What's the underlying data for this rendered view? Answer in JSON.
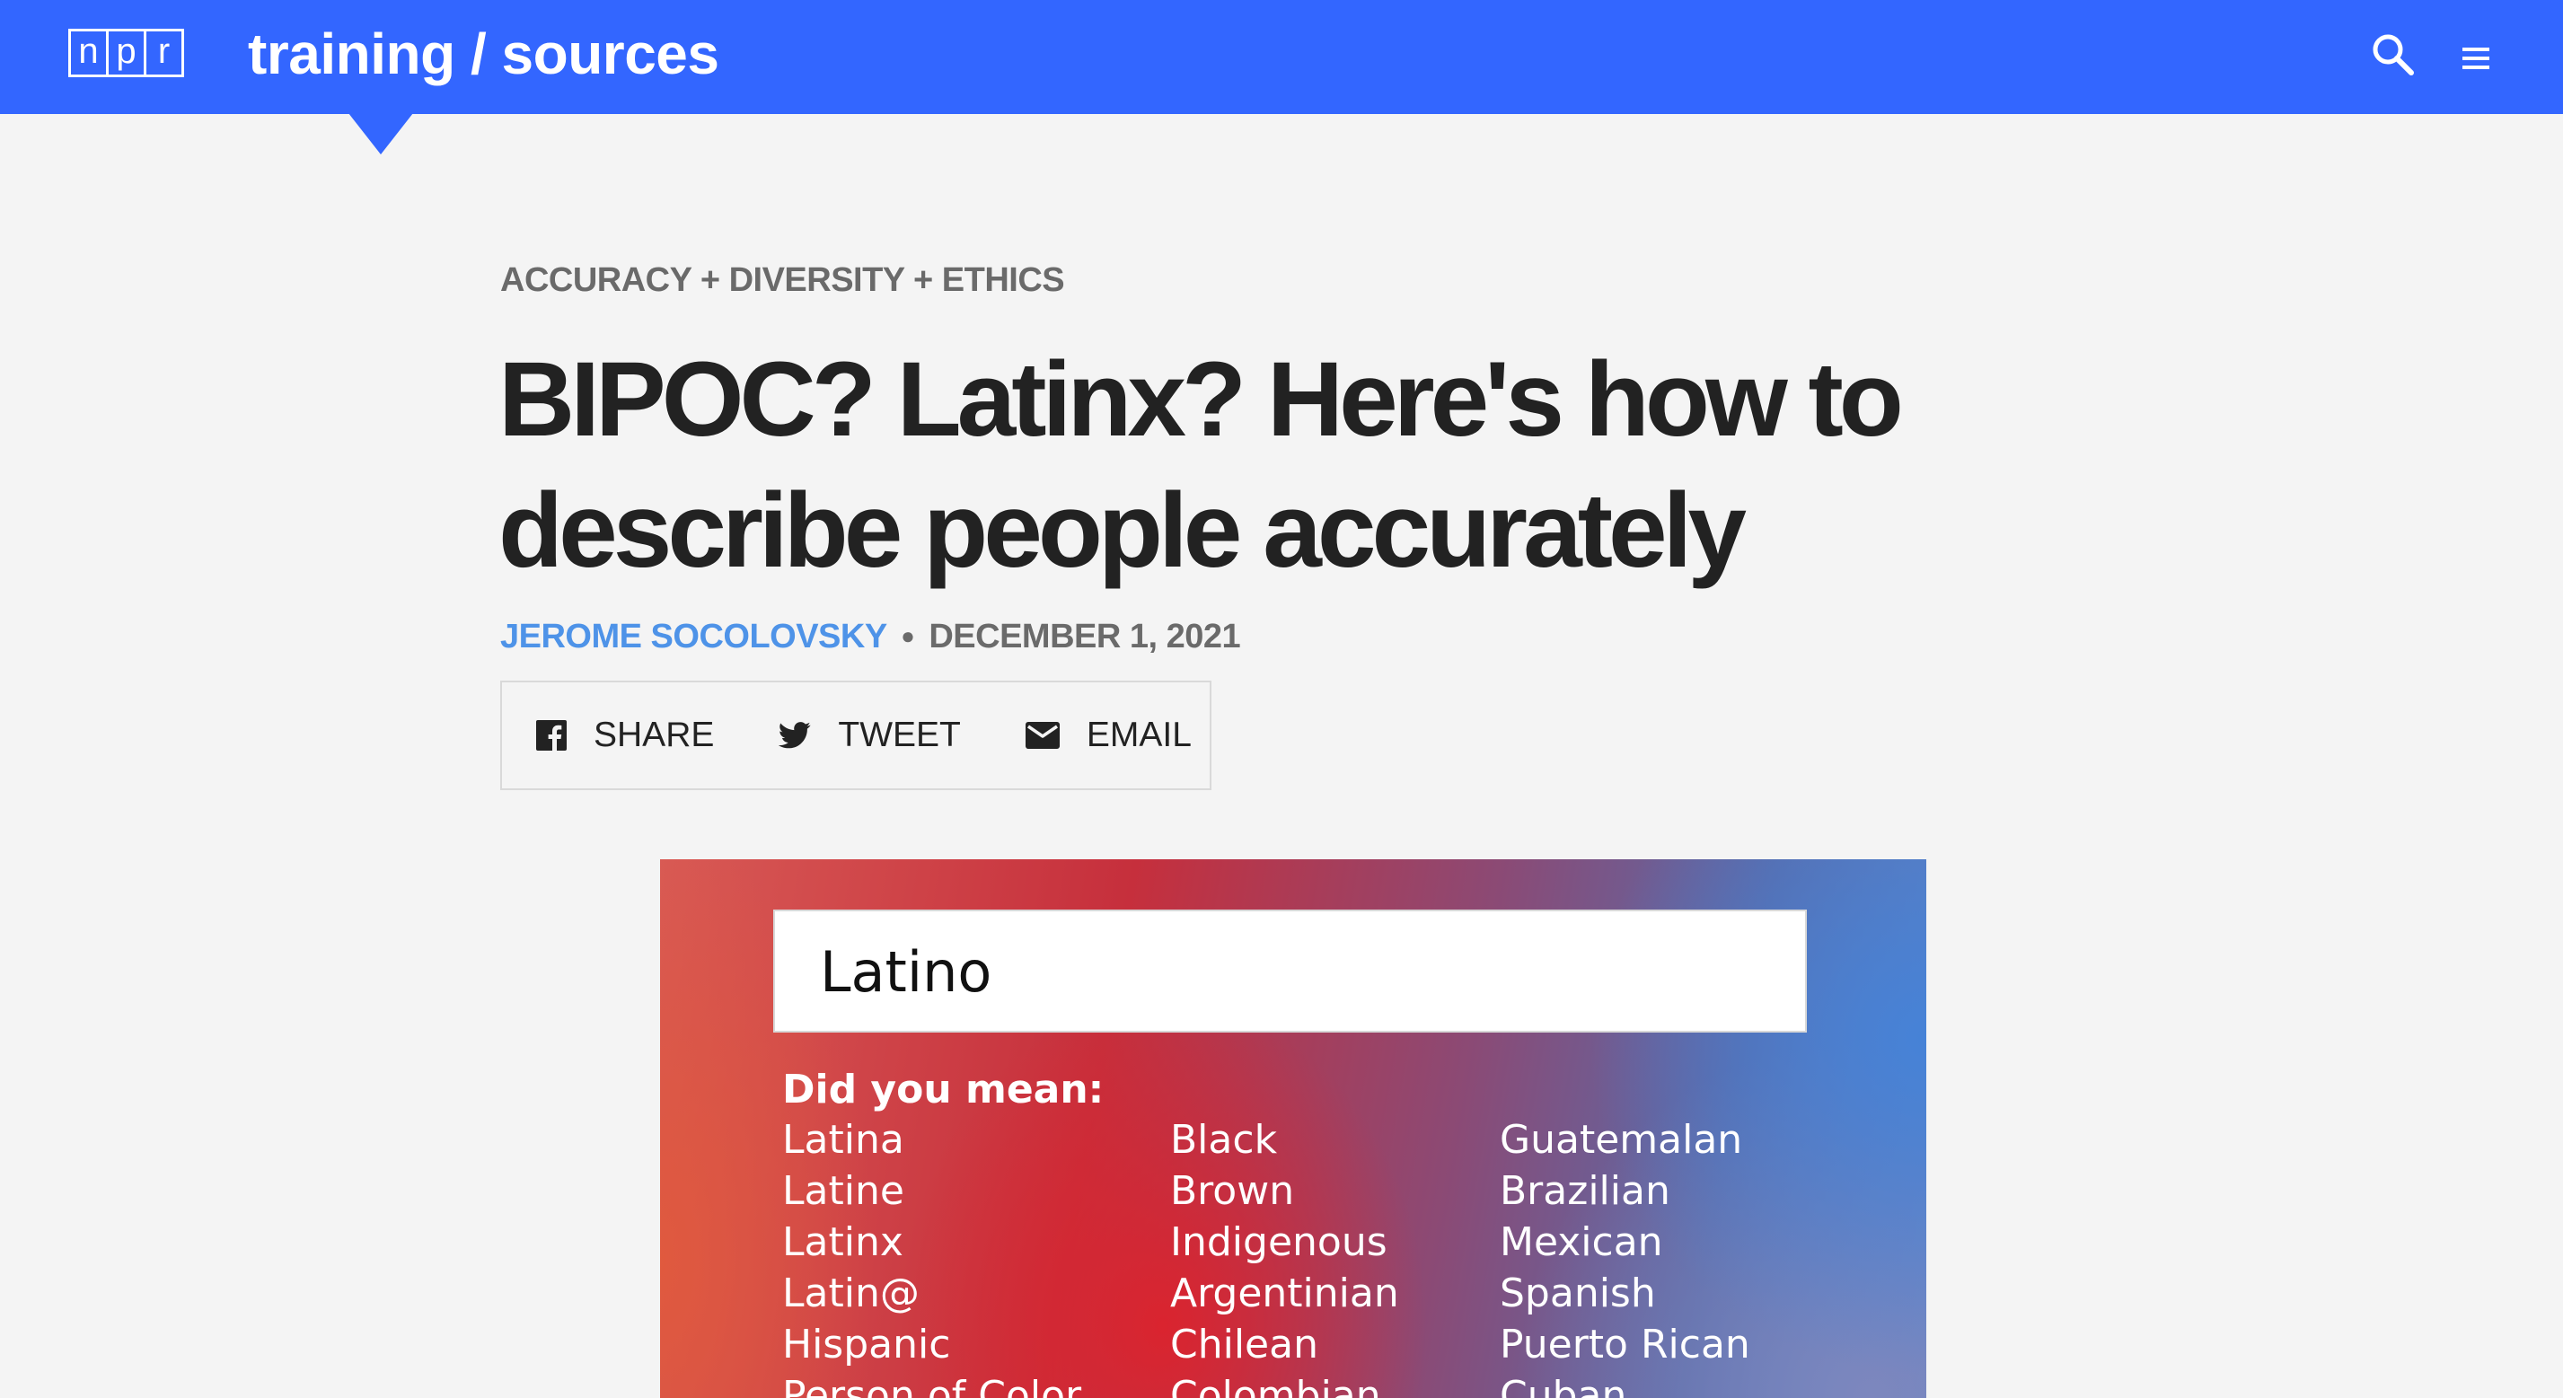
{
  "header": {
    "logo_letters": [
      "n",
      "p",
      "r"
    ],
    "site_title": "training / sources",
    "brand_color": "#3366ff",
    "icons": [
      "search-icon",
      "menu-icon"
    ]
  },
  "article": {
    "category": "ACCURACY + DIVERSITY + ETHICS",
    "headline": "BIPOC? Latinx? Here's how to describe people accurately",
    "author": "JEROME SOCOLOVSKY",
    "separator": "●",
    "date": "DECEMBER 1, 2021"
  },
  "share": {
    "share_label": "SHARE",
    "tweet_label": "TWEET",
    "email_label": "EMAIL"
  },
  "lead_image": {
    "search_value": "Latino",
    "prompt": "Did you mean:",
    "column_1": [
      "Latina",
      "Latine",
      "Latinx",
      "Latin@",
      "Hispanic",
      "Person of Color"
    ],
    "column_2": [
      "Black",
      "Brown",
      "Indigenous",
      "Argentinian",
      "Chilean",
      "Colombian"
    ],
    "column_3": [
      "Guatemalan",
      "Brazilian",
      "Mexican",
      "Spanish",
      "Puerto Rican",
      "Cuban"
    ]
  }
}
